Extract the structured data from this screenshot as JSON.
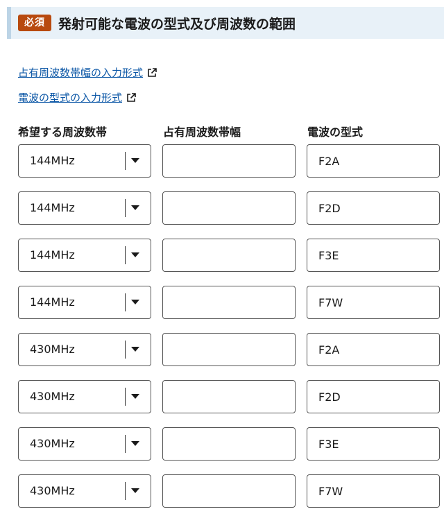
{
  "section": {
    "required_badge": "必須",
    "title": "発射可能な電波の型式及び周波数の範囲"
  },
  "links": {
    "bandwidth_help": "占有周波数帯幅の入力形式",
    "emission_help": "電波の型式の入力形式"
  },
  "columns": {
    "frequency": "希望する周波数帯",
    "bandwidth": "占有周波数帯幅",
    "emission": "電波の型式"
  },
  "rows": [
    {
      "frequency": "144MHz",
      "bandwidth": "",
      "emission": "F2A"
    },
    {
      "frequency": "144MHz",
      "bandwidth": "",
      "emission": "F2D"
    },
    {
      "frequency": "144MHz",
      "bandwidth": "",
      "emission": "F3E"
    },
    {
      "frequency": "144MHz",
      "bandwidth": "",
      "emission": "F7W"
    },
    {
      "frequency": "430MHz",
      "bandwidth": "",
      "emission": "F2A"
    },
    {
      "frequency": "430MHz",
      "bandwidth": "",
      "emission": "F2D"
    },
    {
      "frequency": "430MHz",
      "bandwidth": "",
      "emission": "F3E"
    },
    {
      "frequency": "430MHz",
      "bandwidth": "",
      "emission": "F7W"
    }
  ],
  "colors": {
    "badge": "#b84a0f",
    "link": "#0a56a6",
    "header_bg": "#e8f1f8"
  }
}
